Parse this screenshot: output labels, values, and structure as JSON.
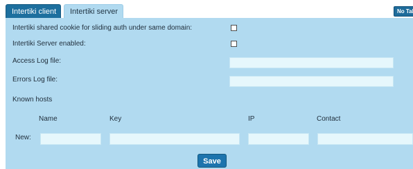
{
  "tabs": [
    {
      "label": "Intertiki client",
      "active": false
    },
    {
      "label": "Intertiki server",
      "active": true
    }
  ],
  "no_tab_button": {
    "label": "No Tabs"
  },
  "form": {
    "shared_cookie_label": "Intertiki shared cookie for sliding auth under same domain:",
    "shared_cookie_checked": false,
    "server_enabled_label": "Intertiki Server enabled:",
    "server_enabled_checked": false,
    "access_log_label": "Access Log file:",
    "access_log_value": "",
    "errors_log_label": "Errors Log file:",
    "errors_log_value": ""
  },
  "known_hosts": {
    "title": "Known hosts",
    "columns": [
      "Name",
      "Key",
      "IP",
      "Contact"
    ],
    "new_row_label": "New:",
    "new_row_values": [
      "",
      "",
      "",
      ""
    ]
  },
  "save_button": {
    "label": "Save"
  },
  "colors": {
    "panel_bg": "#b1daf0",
    "inactive_tab_bg": "#1d6f9e",
    "field_bg": "#e6f7fc",
    "button_bg": "#1d74ad"
  }
}
